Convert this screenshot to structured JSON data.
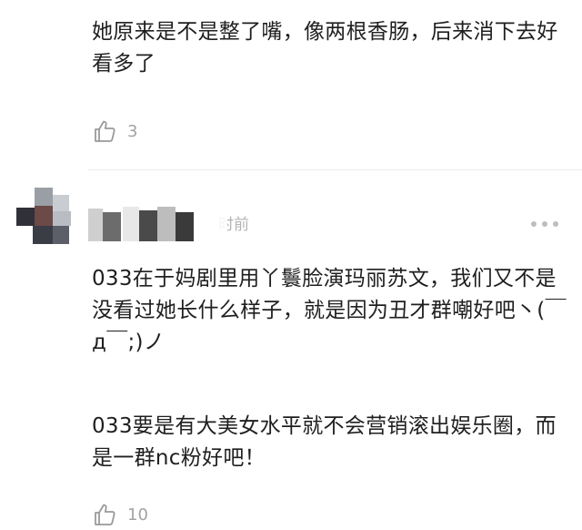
{
  "comments": [
    {
      "text": "她原来是不是整了嘴，像两根香肠，后来消下去好看多了",
      "likes": "3"
    },
    {
      "author": "",
      "time": "时前",
      "paragraphs": [
        "033在于妈剧里用丫鬟脸演玛丽苏文，我们又不是没看过她长什么样子，就是因为丑才群嘲好吧丶(￣д￣;)ノ",
        "033要是有大美女水平就不会营销滚出娱乐圈，而是一群nc粉好吧！"
      ],
      "likes": "10"
    }
  ],
  "icons": {
    "like": "thumbs-up-icon",
    "more": "more-dots-icon"
  },
  "colors": {
    "text": "#1f1f1f",
    "meta": "#9a9a9a",
    "divider": "#ececec"
  }
}
